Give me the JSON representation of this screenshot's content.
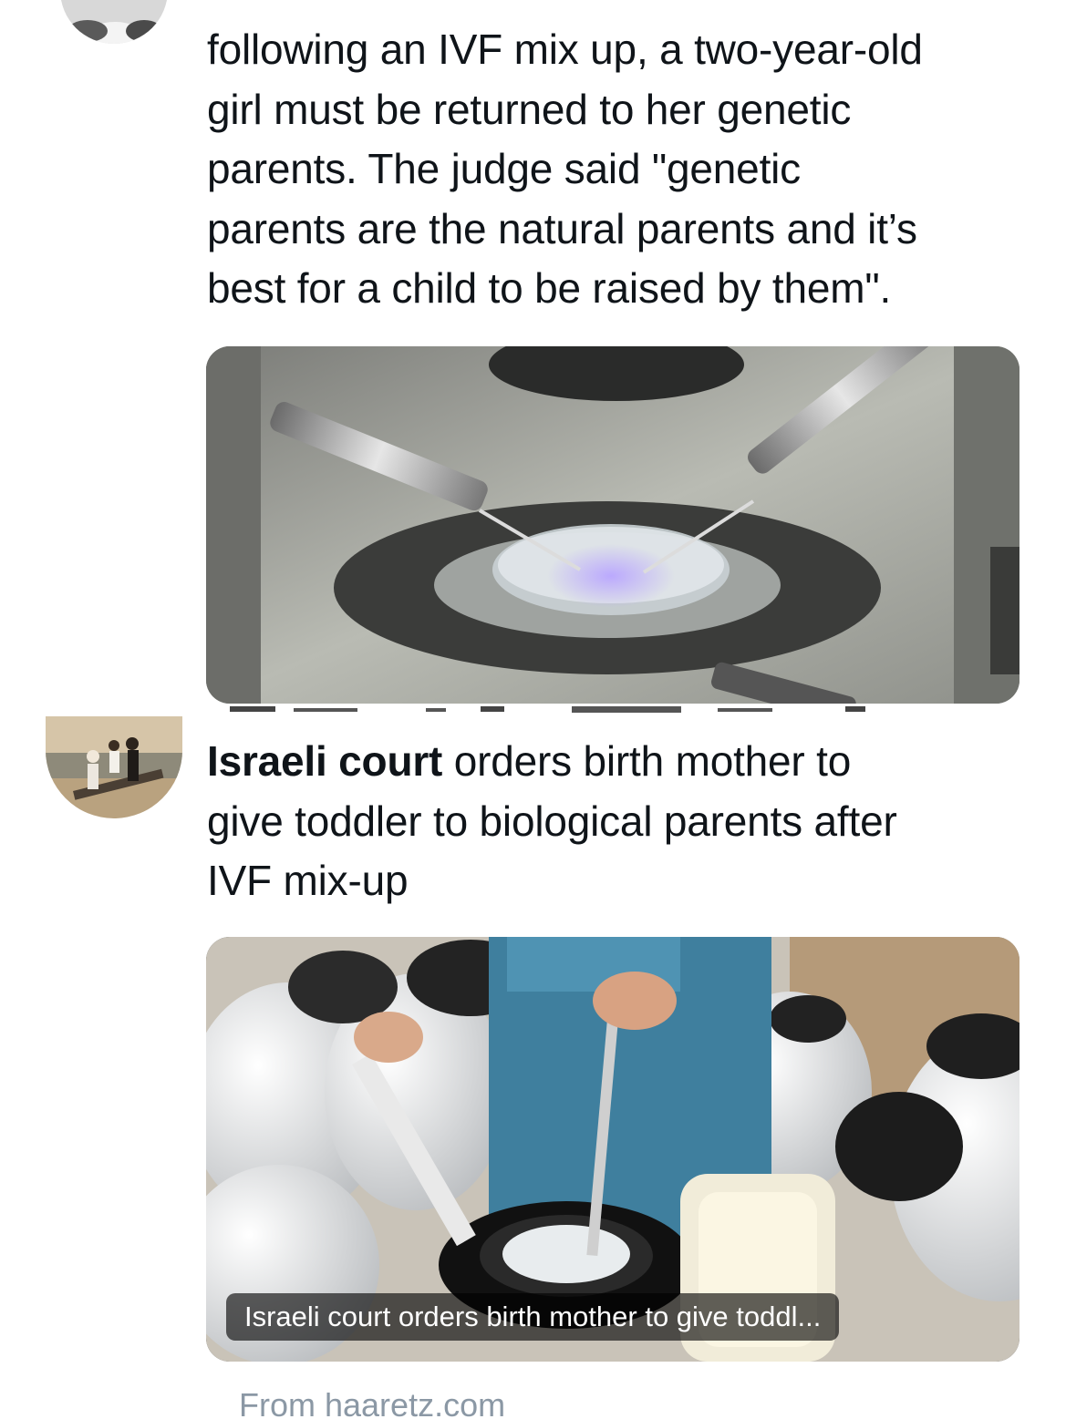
{
  "tweet1": {
    "text": "following an IVF mix up, a two-year-old\ngirl must be returned to her genetic\nparents. The judge said \"genetic\nparents are the natural parents and it’s\nbest for a child to be raised by them\".",
    "image_icon": "ivf-lab-photo"
  },
  "tweet2": {
    "text_bold": "Israeli court",
    "text_rest": " orders birth mother to\ngive toddler to biological parents after\nIVF mix-up",
    "card_title": "Israeli court orders birth mother to give toddl...",
    "source": "From haaretz.com",
    "image_icon": "cryo-storage-photo"
  },
  "colors": {
    "text": "#0f1419",
    "muted": "#8b98a5",
    "background": "#ffffff"
  }
}
